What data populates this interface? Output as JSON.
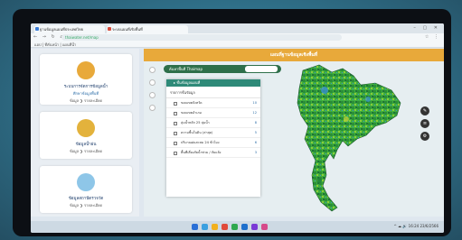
{
  "browser": {
    "tabs": [
      {
        "title": "ฐานข้อมูลแผนที่ประเทศไทย",
        "color": "#3a7bd5"
      },
      {
        "title": "ระบบแผนที่เชิงพื้นที่",
        "color": "#d94a3a"
      }
    ],
    "window_controls": "– ▢ ✕",
    "nav_icons": "← → ↻ ⌂",
    "url": "thaiwater.net/map",
    "toolbar_icons": "☆ ⋮",
    "bookmarks": "แอป   |   ที่คั่นหน้า   |   แผนที่น้ำ"
  },
  "sidebar": {
    "cards": [
      {
        "line1": "ระบบการจัดการข้อมูลน้ำ",
        "line2": "ศึกษาข้อมูลพื้นที่",
        "line3": "ข้อมูล ❯  รายละเอียด",
        "icon_color": "#e8a93a",
        "icon": "mail-icon"
      },
      {
        "line1": "ข้อมูลน้ำฝน",
        "line2": "",
        "line3": "ข้อมูล ❯  รายละเอียด",
        "icon_color": "#e3b23c",
        "icon": "rain-icon"
      },
      {
        "line1": "ข้อมูลสถานีตรวจวัด",
        "line2": "",
        "line3": "ข้อมูล ❯  รายละเอียด",
        "icon_color": "#8ec6e8",
        "icon": "station-icon"
      }
    ]
  },
  "map": {
    "title": "แผนที่ฐานข้อมูลเชิงพื้นที่",
    "search_label": "ค้นหาพื้นที่ Thaimap",
    "layer_panel": {
      "header": "▸ ชั้นข้อมูลแผนที่",
      "subheader": "รายการชั้นข้อมูล",
      "rows": [
        {
          "label": "ขอบเขตจังหวัด",
          "value": "10"
        },
        {
          "label": "ขอบเขตอำเภอ",
          "value": "12"
        },
        {
          "label": "ลุ่มน้ำหลัก 25 ลุ่มน้ำ",
          "value": "8"
        },
        {
          "label": "ความชื้นในดิน (ล่าสุด)",
          "value": "5"
        },
        {
          "label": "ปริมาณฝนสะสม 24 ชั่วโมง",
          "value": "6"
        },
        {
          "label": "พื้นที่เสี่ยงภัยน้ำท่วม / ภัยแล้ง",
          "value": "3"
        }
      ]
    },
    "controls": [
      "+",
      "−",
      "⌖"
    ],
    "right_controls": [
      "✎",
      "≡",
      "⚙"
    ],
    "region_colors": [
      "#2f9e3f",
      "#4fb640",
      "#7cc63c",
      "#1e7f3a",
      "#3a8fd0",
      "#b9d13a"
    ]
  },
  "taskbar": {
    "icon_colors": [
      "#2a6fd6",
      "#3ba0e0",
      "#f2b01e",
      "#e04a3a",
      "#2fa84f",
      "#1e6fcc",
      "#7a3ad6",
      "#d64a8a"
    ],
    "tray_text": "^  ☁  🔊  16:24  23/6/2566"
  }
}
